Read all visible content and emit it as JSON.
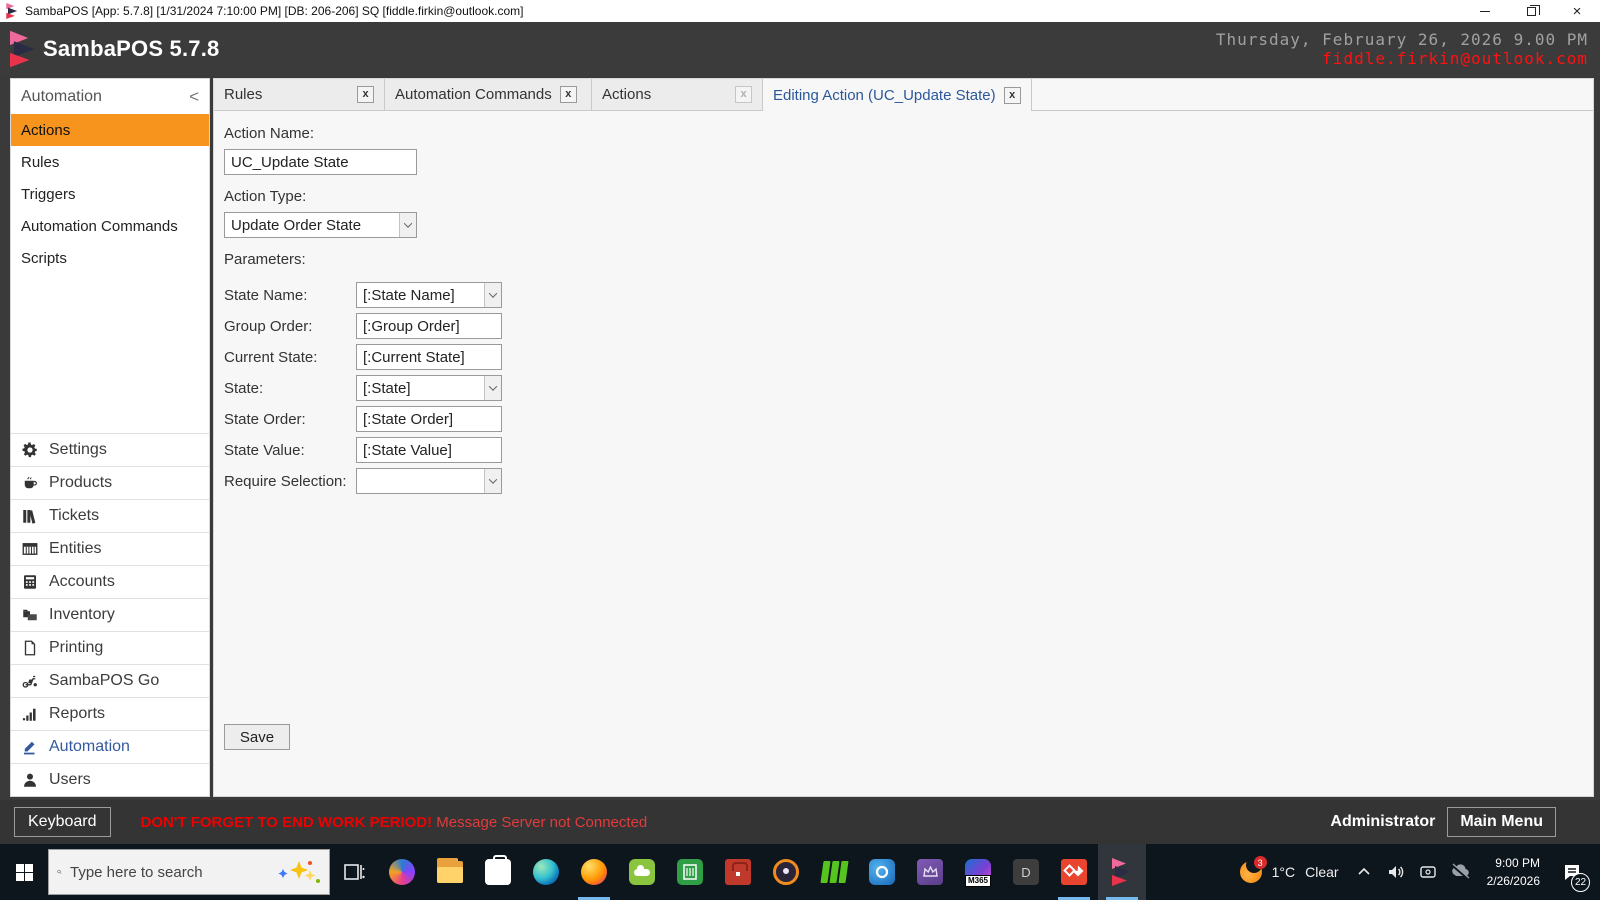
{
  "window": {
    "title": "SambaPOS [App: 5.7.8] [1/31/2024 7:10:00 PM] [DB: 206-206] SQ [fiddle.firkin@outlook.com]",
    "controls": [
      "minimize",
      "restore",
      "close"
    ]
  },
  "header": {
    "brand": "SambaPOS 5.7.8",
    "datetime": "Thursday, February 26, 2026 9.00 PM",
    "email": "fiddle.firkin@outlook.com"
  },
  "sidebar": {
    "section_title": "Automation",
    "collapse_icon": "<",
    "items": [
      {
        "label": "Actions",
        "selected": true
      },
      {
        "label": "Rules"
      },
      {
        "label": "Triggers"
      },
      {
        "label": "Automation Commands"
      },
      {
        "label": "Scripts"
      }
    ],
    "modules": [
      {
        "label": "Settings",
        "icon": "gear-icon"
      },
      {
        "label": "Products",
        "icon": "coffee-cup-icon"
      },
      {
        "label": "Tickets",
        "icon": "books-icon"
      },
      {
        "label": "Entities",
        "icon": "table-grid-icon"
      },
      {
        "label": "Accounts",
        "icon": "calculator-icon"
      },
      {
        "label": "Inventory",
        "icon": "folders-icon"
      },
      {
        "label": "Printing",
        "icon": "document-icon"
      },
      {
        "label": "SambaPOS Go",
        "icon": "scooter-icon"
      },
      {
        "label": "Reports",
        "icon": "bar-chart-icon"
      },
      {
        "label": "Automation",
        "icon": "pencil-icon",
        "active": true
      },
      {
        "label": "Users",
        "icon": "person-icon"
      }
    ]
  },
  "tabs": [
    {
      "label": "Rules",
      "close": "x"
    },
    {
      "label": "Automation Commands",
      "close": "x"
    },
    {
      "label": "Actions",
      "close": "x"
    },
    {
      "label": "Editing Action (UC_Update State)",
      "close": "x",
      "active": true
    }
  ],
  "form": {
    "action_name_label": "Action Name:",
    "action_name_value": "UC_Update State",
    "action_type_label": "Action Type:",
    "action_type_value": "Update Order State",
    "parameters_label": "Parameters:",
    "parameters": [
      {
        "label": "State Name:",
        "value": "[:State Name]",
        "type": "select"
      },
      {
        "label": "Group Order:",
        "value": "[:Group Order]",
        "type": "text"
      },
      {
        "label": "Current State:",
        "value": "[:Current State]",
        "type": "text"
      },
      {
        "label": "State:",
        "value": "[:State]",
        "type": "select"
      },
      {
        "label": "State Order:",
        "value": "[:State Order]",
        "type": "text"
      },
      {
        "label": "State Value:",
        "value": "[:State Value]",
        "type": "text"
      },
      {
        "label": "Require Selection:",
        "value": "",
        "type": "select"
      }
    ],
    "save_label": "Save"
  },
  "statusbar": {
    "keyboard_label": "Keyboard",
    "warning_bold": "DON'T FORGET TO END WORK PERIOD!",
    "warning_normal": "Message Server not Connected",
    "user": "Administrator",
    "main_menu_label": "Main Menu"
  },
  "taskbar": {
    "search_placeholder": "Type here to search",
    "apps": [
      "task-view",
      "copilot",
      "file-explorer",
      "microsoft-store",
      "edge",
      "firefox",
      "green-cloud-drive",
      "green-book",
      "toolbox",
      "security-shield",
      "green-panels",
      "outlook",
      "crown-app",
      "m365-copilot",
      "d-app",
      "red-diamond-app",
      "sambapos"
    ],
    "m365_label": "M365",
    "d_label": "D",
    "tray": {
      "weather_badge": "3",
      "temperature": "1°C",
      "condition": "Clear",
      "time": "9:00 PM",
      "date": "2/26/2026",
      "notification_count": "22"
    }
  }
}
